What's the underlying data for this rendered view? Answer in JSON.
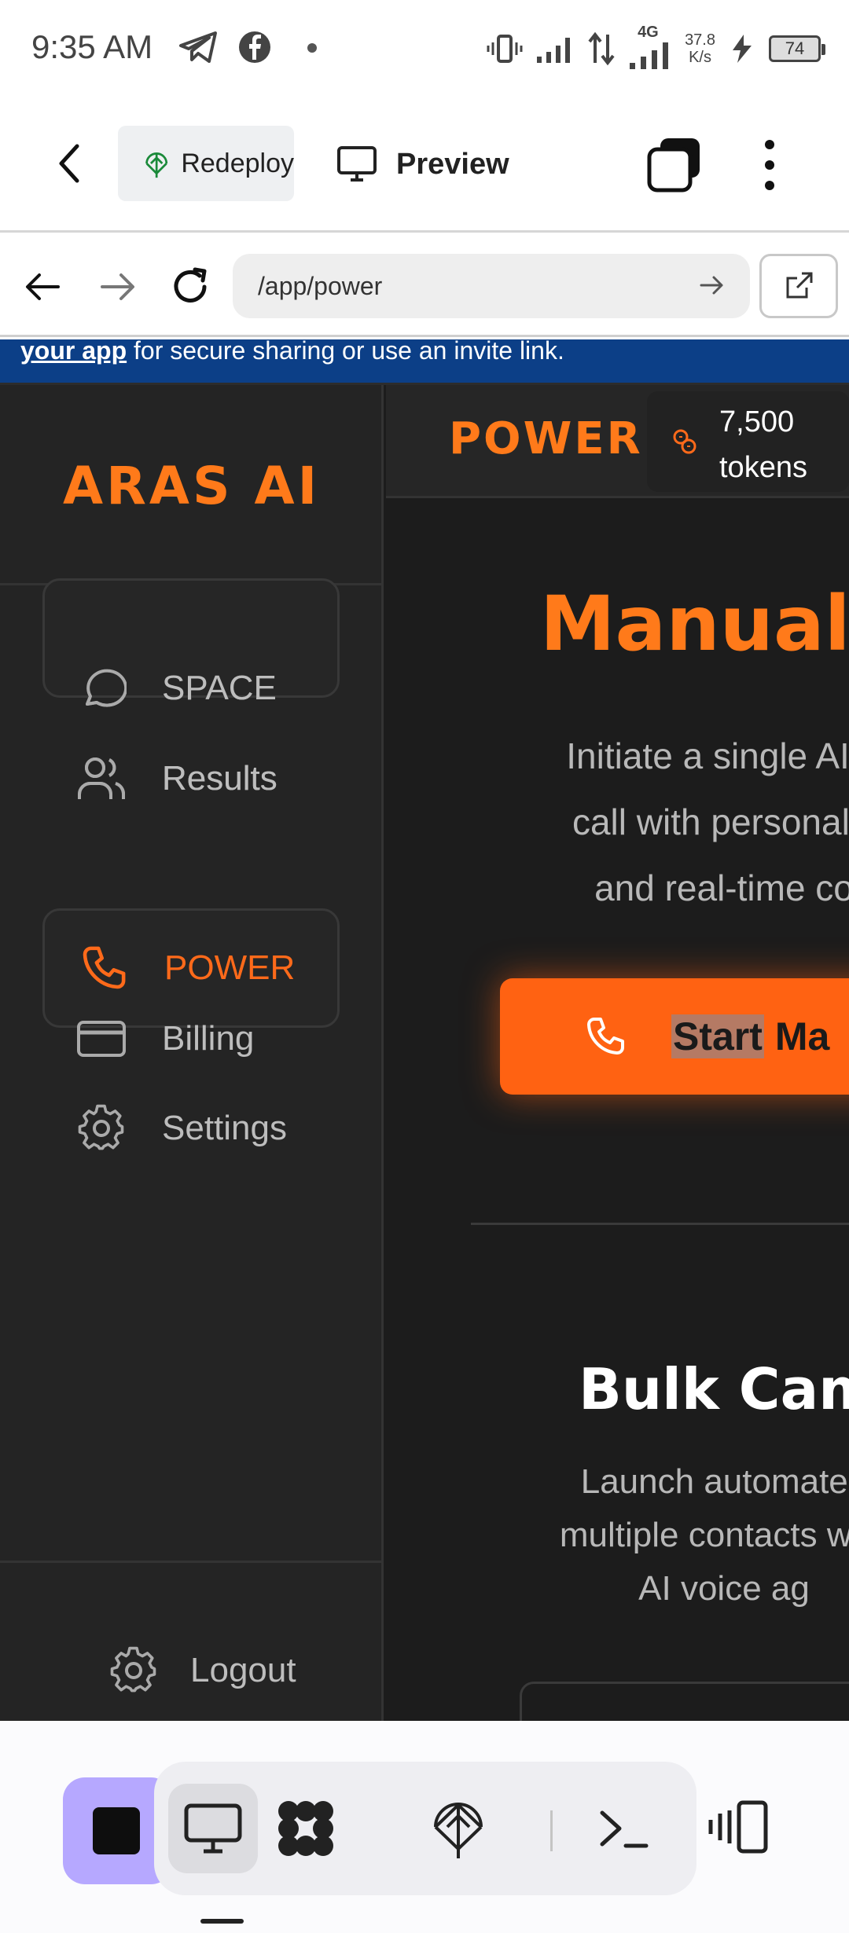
{
  "status_bar": {
    "time": "9:35 AM",
    "network": "4G",
    "speed_value": "37.8",
    "speed_unit": "K/s",
    "battery": "74"
  },
  "top_bar": {
    "redeploy_label": "Redeploy",
    "preview_label": "Preview"
  },
  "browser": {
    "url": "/app/power"
  },
  "banner": {
    "link_text": "your app",
    "text": " for secure sharing or use an invite link."
  },
  "sidebar": {
    "logo": "ARAS AI",
    "items": [
      {
        "label": "SPACE",
        "icon": "chat-bubble-icon"
      },
      {
        "label": "Results",
        "icon": "users-icon"
      },
      {
        "label": "POWER",
        "icon": "phone-icon",
        "active": true
      },
      {
        "label": "Billing",
        "icon": "credit-card-icon"
      },
      {
        "label": "Settings",
        "icon": "gear-icon"
      }
    ],
    "logout_label": "Logout"
  },
  "header": {
    "title": "POWER",
    "tokens_value": "7,500",
    "tokens_label": "tokens"
  },
  "manual": {
    "title": "Manual",
    "desc_line1": "Initiate a single AI-p",
    "desc_line2": "call with personaliz",
    "desc_line3": "and real-time co",
    "button_label_selected": "Start",
    "button_label_rest": " Ma"
  },
  "bulk": {
    "title": "Bulk Cam",
    "desc_line1": "Launch automated",
    "desc_line2": "multiple contacts with",
    "desc_line3": "AI voice ag"
  },
  "colors": {
    "accent_orange": "#ff6212",
    "brand_orange": "#ff7a1a",
    "stop_button": "#b6a8ff",
    "banner_blue": "#0c3f87"
  }
}
